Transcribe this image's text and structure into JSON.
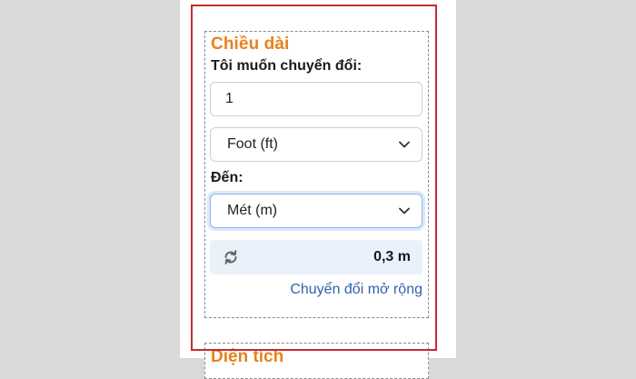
{
  "length_card": {
    "title": "Chiều dài",
    "from_label": "Tôi muốn chuyển đổi:",
    "input_value": "1",
    "from_unit": "Foot (ft)",
    "to_label": "Đến:",
    "to_unit": "Mét (m)",
    "result": "0,3 m",
    "extended_link": "Chuyển đổi mở rộng",
    "icons": {
      "swap": "refresh-icon",
      "dropdown": "chevron-down-icon"
    }
  },
  "next_card": {
    "title": "Diện tích"
  },
  "colors": {
    "title_orange": "#e8821e",
    "link_blue": "#2f64a8",
    "highlight_red": "#c62b32",
    "result_bg": "#eaf1fb"
  }
}
